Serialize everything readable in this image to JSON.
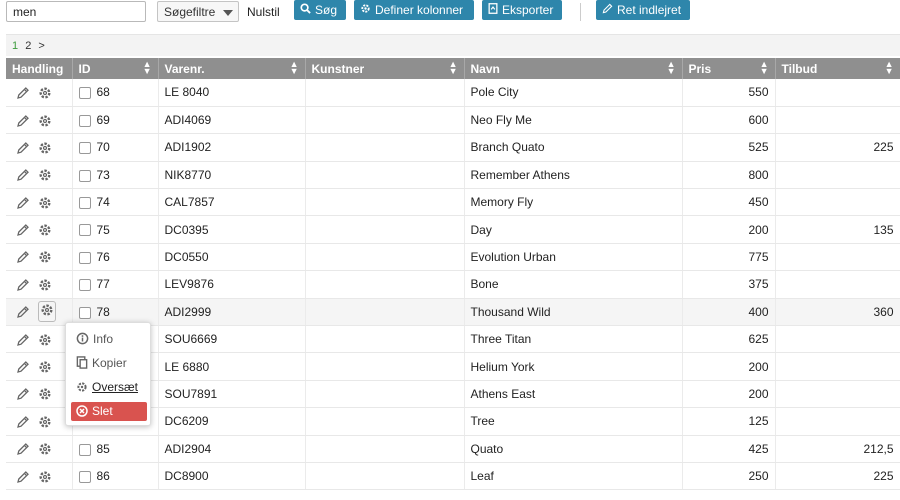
{
  "toolbar": {
    "search_value": "men",
    "filter_label": "Søgefiltre",
    "reset_label": "Nulstil",
    "search_label": "Søg",
    "columns_label": "Definer kolonner",
    "export_label": "Eksporter",
    "edit_label": "Ret indlejret"
  },
  "pager": {
    "current": "1",
    "next": "2",
    "more": ">"
  },
  "columns": {
    "handling": "Handling",
    "id": "ID",
    "varenr": "Varenr.",
    "kunstner": "Kunstner",
    "navn": "Navn",
    "pris": "Pris",
    "tilbud": "Tilbud"
  },
  "rows": [
    {
      "id": "68",
      "varenr": "LE 8040",
      "kunstner": "",
      "navn": "Pole City",
      "pris": "550",
      "tilbud": ""
    },
    {
      "id": "69",
      "varenr": "ADI4069",
      "kunstner": "",
      "navn": "Neo Fly Me",
      "pris": "600",
      "tilbud": ""
    },
    {
      "id": "70",
      "varenr": "ADI1902",
      "kunstner": "",
      "navn": "Branch Quato",
      "pris": "525",
      "tilbud": "225"
    },
    {
      "id": "73",
      "varenr": "NIK8770",
      "kunstner": "",
      "navn": "Remember Athens",
      "pris": "800",
      "tilbud": ""
    },
    {
      "id": "74",
      "varenr": "CAL7857",
      "kunstner": "",
      "navn": "Memory Fly",
      "pris": "450",
      "tilbud": ""
    },
    {
      "id": "75",
      "varenr": "DC0395",
      "kunstner": "",
      "navn": "Day",
      "pris": "200",
      "tilbud": "135"
    },
    {
      "id": "76",
      "varenr": "DC0550",
      "kunstner": "",
      "navn": "Evolution Urban",
      "pris": "775",
      "tilbud": ""
    },
    {
      "id": "77",
      "varenr": "LEV9876",
      "kunstner": "",
      "navn": "Bone",
      "pris": "375",
      "tilbud": ""
    },
    {
      "id": "78",
      "varenr": "ADI2999",
      "kunstner": "",
      "navn": "Thousand Wild",
      "pris": "400",
      "tilbud": "360"
    },
    {
      "id": "",
      "varenr": "SOU6669",
      "kunstner": "",
      "navn": "Three Titan",
      "pris": "625",
      "tilbud": ""
    },
    {
      "id": "",
      "varenr": "LE 6880",
      "kunstner": "",
      "navn": "Helium York",
      "pris": "200",
      "tilbud": ""
    },
    {
      "id": "",
      "varenr": "SOU7891",
      "kunstner": "",
      "navn": "Athens East",
      "pris": "200",
      "tilbud": ""
    },
    {
      "id": "",
      "varenr": "DC6209",
      "kunstner": "",
      "navn": "Tree",
      "pris": "125",
      "tilbud": ""
    },
    {
      "id": "85",
      "varenr": "ADI2904",
      "kunstner": "",
      "navn": "Quato",
      "pris": "425",
      "tilbud": "212,5"
    },
    {
      "id": "86",
      "varenr": "DC8900",
      "kunstner": "",
      "navn": "Leaf",
      "pris": "250",
      "tilbud": "225"
    }
  ],
  "context_menu": {
    "info": "Info",
    "copy": "Kopier",
    "translate": "Oversæt",
    "delete": "Slet"
  },
  "colors": {
    "primary": "#2e86ab",
    "header": "#8f8f8f",
    "danger": "#d9534f",
    "pager_active": "#3c9b3c"
  }
}
